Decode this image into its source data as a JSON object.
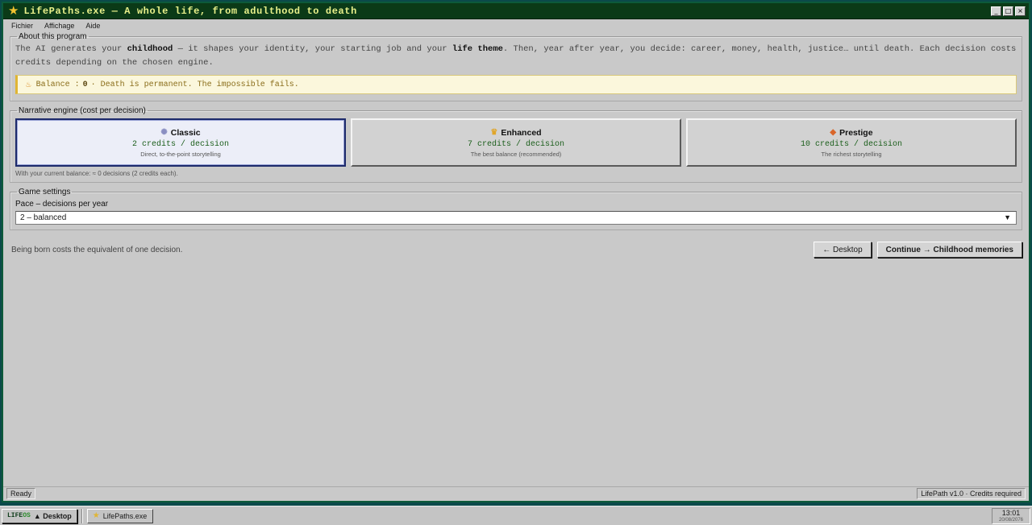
{
  "window": {
    "title": "LifePaths.exe — A whole life, from adulthood to death",
    "min_label": "_",
    "max_label": "□",
    "close_label": "×"
  },
  "menu": [
    "Fichier",
    "Affichage",
    "Aide"
  ],
  "about": {
    "legend": "About this program",
    "text_1": "The AI generates your ",
    "bold_1": "childhood",
    "text_2": " — it shapes your identity, your starting job and your ",
    "bold_2": "life theme",
    "text_3": ". Then, year after year, you decide: career, money, health, justice… until death. Each decision costs credits depending on the chosen engine.",
    "balance_label": "Balance :",
    "balance_value": "0",
    "balance_note": "· Death is permanent. The impossible fails."
  },
  "engine": {
    "legend": "Narrative engine (cost per decision)",
    "options": [
      {
        "name": "Classic",
        "cost": "2 credits / decision",
        "desc": "Direct, to-the-point storytelling",
        "icon": "sparkle-icon",
        "glyph": "✺"
      },
      {
        "name": "Enhanced",
        "cost": "7 credits / decision",
        "desc": "The best balance (recommended)",
        "icon": "crown-icon",
        "glyph": "♛"
      },
      {
        "name": "Prestige",
        "cost": "10 credits / decision",
        "desc": "The richest storytelling",
        "icon": "gem-icon",
        "glyph": "◆"
      }
    ],
    "hint": "With your current balance: ≈ 0 decisions (2 credits each)."
  },
  "settings": {
    "legend": "Game settings",
    "pace_label": "Pace – decisions per year",
    "pace_value": "2 – balanced",
    "arrow": "▼"
  },
  "footer": {
    "note": "Being born costs the equivalent of one decision.",
    "back_label": "← Desktop",
    "continue_label": "Continue → Childhood memories"
  },
  "status": {
    "left": "Ready",
    "right": "LifePath v1.0 · Credits required"
  },
  "taskbar": {
    "brand_a": "LIFE",
    "brand_b": "OS",
    "start_label": "▲ Desktop",
    "task_label": "LifePaths.exe",
    "time": "13:01",
    "date": "20/08/2076"
  },
  "colors": {
    "titlebar": "#0b3a17",
    "title_text": "#e8f08a",
    "selected_border": "#1d2a6b",
    "cost_text": "#1b5e1b",
    "balance_bg": "#fbf7dc"
  }
}
